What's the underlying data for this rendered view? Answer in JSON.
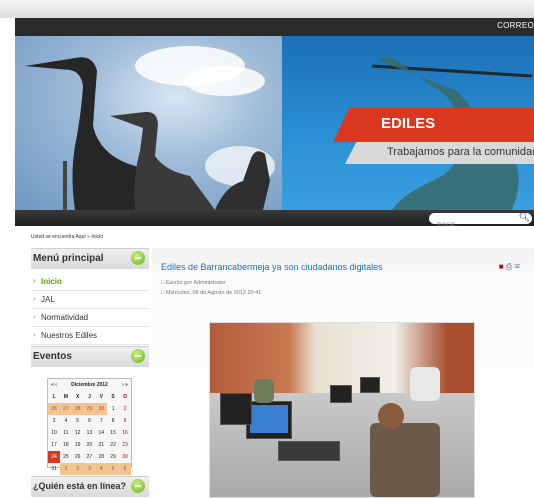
{
  "header": {
    "correo_label": "CORREO"
  },
  "banner": {
    "title": "EDILES",
    "subtitle": "Trabajamos para la comunidad"
  },
  "search": {
    "placeholder": "buscar..."
  },
  "breadcrumb": "Usted se encuentra Aquí » Inicio",
  "sidebar": {
    "menu_title": "Menú principal",
    "menu_items": [
      {
        "label": "Inicio",
        "active": true
      },
      {
        "label": "JAL",
        "active": false
      },
      {
        "label": "Normatividad",
        "active": false
      },
      {
        "label": "Nuestros Ediles",
        "active": false
      }
    ],
    "events_title": "Eventos",
    "online_title": "¿Quién está en línea?"
  },
  "calendar": {
    "nav_prev": "« ‹",
    "month_label": "Diciembre 2012",
    "nav_next": "› »",
    "weekdays": [
      "L",
      "M",
      "X",
      "J",
      "V",
      "S",
      "D"
    ],
    "weeks": [
      [
        "26",
        "27",
        "28",
        "29",
        "30",
        "1",
        "2"
      ],
      [
        "3",
        "4",
        "5",
        "6",
        "7",
        "8",
        "9"
      ],
      [
        "10",
        "11",
        "12",
        "13",
        "14",
        "15",
        "16"
      ],
      [
        "17",
        "18",
        "19",
        "20",
        "21",
        "22",
        "23"
      ],
      [
        "24",
        "25",
        "26",
        "27",
        "28",
        "29",
        "30"
      ],
      [
        "31",
        "1",
        "2",
        "3",
        "4",
        "5",
        "6"
      ]
    ],
    "today": "24"
  },
  "article": {
    "title": "Ediles de Barrancabermeja ya son ciudadanos digitales",
    "author": "Escrito por Administrator",
    "date": "Miércoles, 09 de Agosto de 2012 20:41"
  },
  "colors": {
    "accent_green": "#6cb51c",
    "title_blue": "#1a6fc5",
    "banner_red": "#d9381e"
  }
}
